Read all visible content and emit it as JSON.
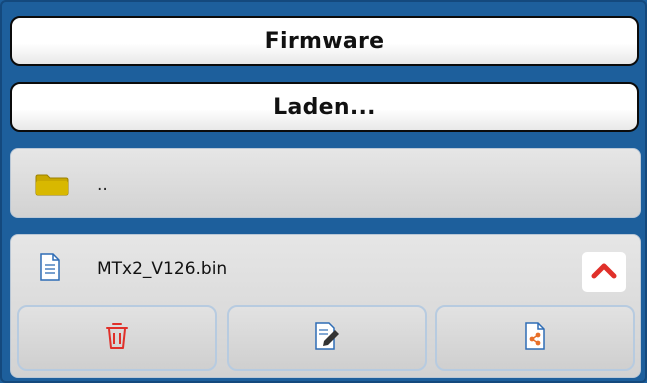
{
  "header": {
    "firmware_label": "Firmware",
    "load_label": "Laden..."
  },
  "file_list": {
    "parent_dir_label": "..",
    "file_name": "MTx2_V126.bin"
  },
  "icons": {
    "folder": "folder-icon",
    "file": "file-icon",
    "collapse": "chevron-up-icon",
    "delete": "trash-icon",
    "edit": "edit-icon",
    "share": "share-icon"
  },
  "colors": {
    "background": "#1d5f9c",
    "folder": "#c9a800",
    "delete_red": "#e0302a",
    "share_orange": "#e8702a",
    "file_blue": "#2f6db5"
  }
}
